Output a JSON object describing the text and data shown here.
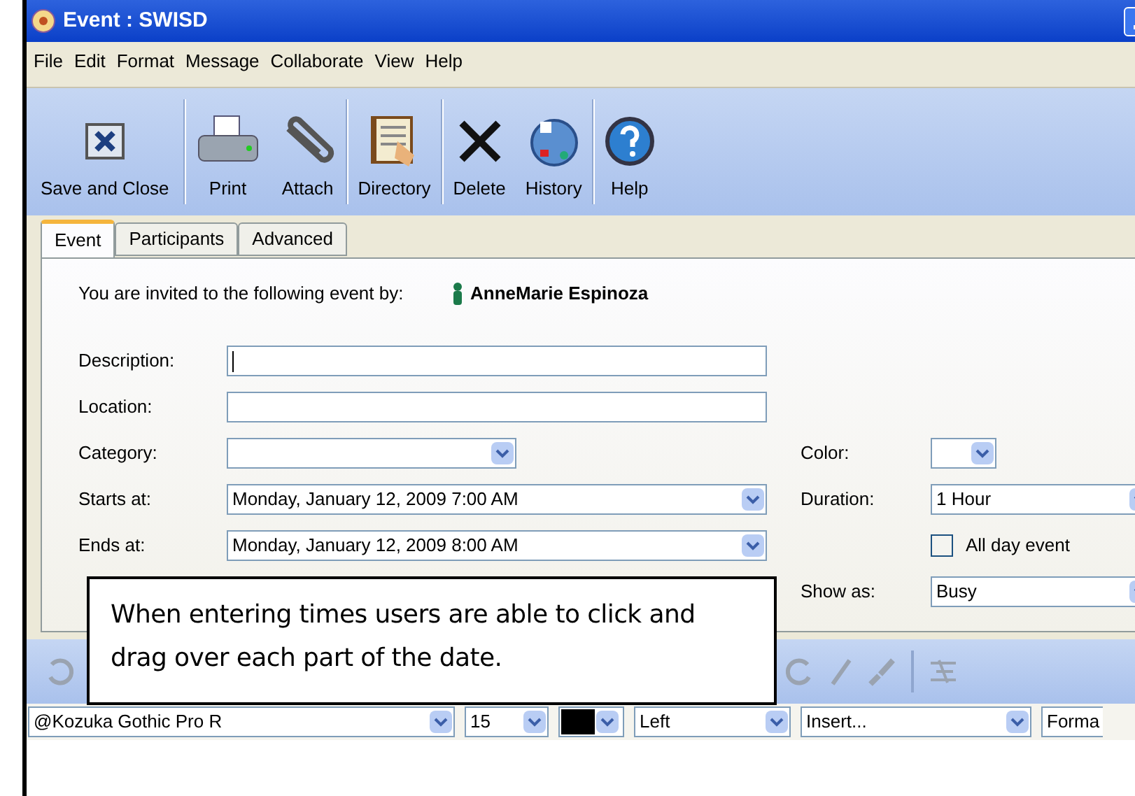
{
  "window": {
    "title": "Event : SWISD"
  },
  "menu": [
    "File",
    "Edit",
    "Format",
    "Message",
    "Collaborate",
    "View",
    "Help"
  ],
  "toolbar": [
    {
      "label": "Save and Close"
    },
    {
      "label": "Print"
    },
    {
      "label": "Attach"
    },
    {
      "label": "Directory"
    },
    {
      "label": "Delete"
    },
    {
      "label": "History"
    },
    {
      "label": "Help"
    }
  ],
  "tabs": [
    {
      "label": "Event",
      "selected": true
    },
    {
      "label": "Participants",
      "selected": false
    },
    {
      "label": "Advanced",
      "selected": false
    }
  ],
  "invitation": {
    "text": "You are invited to the following event by:",
    "organizer": "AnneMarie Espinoza"
  },
  "form": {
    "description": {
      "label": "Description:"
    },
    "location": {
      "label": "Location:"
    },
    "category": {
      "label": "Category:"
    },
    "color": {
      "label": "Color:"
    },
    "starts": {
      "label": "Starts at:",
      "value": "Monday, January 12, 2009 7:00 AM"
    },
    "duration": {
      "label": "Duration:",
      "value": "1 Hour"
    },
    "ends": {
      "label": "Ends at:",
      "value": "Monday, January 12, 2009 8:00 AM"
    },
    "all_day": {
      "label": "All day event",
      "checked": false
    },
    "show_as": {
      "label": "Show as:",
      "value": "Busy"
    }
  },
  "callout": "When entering times users are able to click and drag over each part of the date.",
  "format_bar": {
    "font": "@Kozuka Gothic Pro R",
    "size": "15",
    "color": "#000000",
    "align": "Left",
    "insert": "Insert...",
    "format": "Forma"
  }
}
